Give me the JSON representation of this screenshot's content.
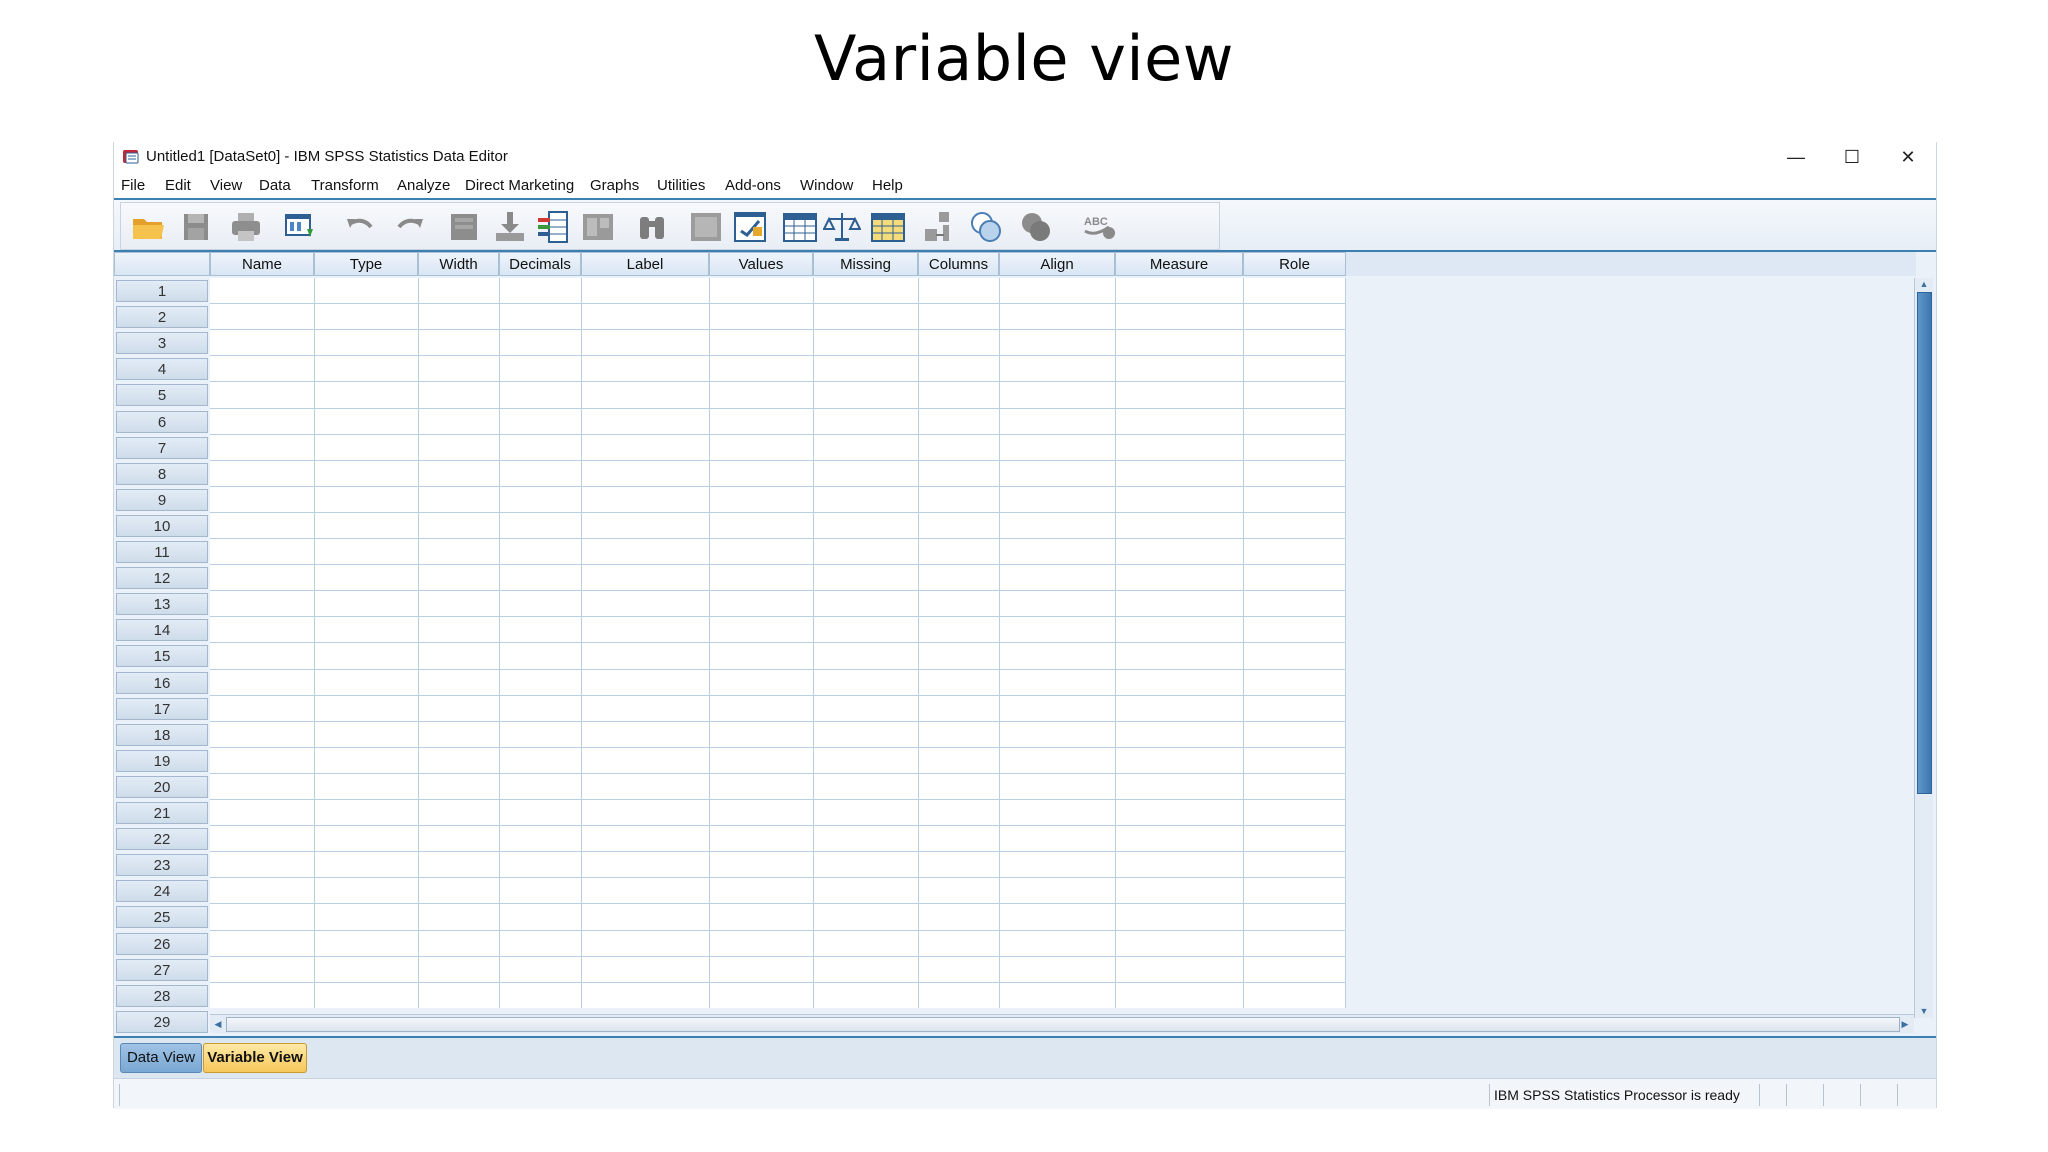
{
  "slide": {
    "title": "Variable view"
  },
  "window": {
    "title": "Untitled1 [DataSet0] - IBM SPSS Statistics Data Editor",
    "controls": {
      "minimize": "—",
      "maximize": "☐",
      "close": "✕"
    }
  },
  "menu": [
    "File",
    "Edit",
    "View",
    "Data",
    "Transform",
    "Analyze",
    "Direct Marketing",
    "Graphs",
    "Utilities",
    "Add-ons",
    "Window",
    "Help"
  ],
  "toolbar": {
    "buttons": [
      "open-folder",
      "save",
      "print",
      "recall-dialog",
      "undo",
      "redo",
      "go-to-case",
      "go-to-variable",
      "variables",
      "split-file",
      "find",
      "insert-cases",
      "insert-variable",
      "split-file-table",
      "weight-cases",
      "select-cases",
      "value-labels",
      "use-sets",
      "show-all-variables",
      "spell-check"
    ]
  },
  "grid": {
    "columns": [
      "Name",
      "Type",
      "Width",
      "Decimals",
      "Label",
      "Values",
      "Missing",
      "Columns",
      "Align",
      "Measure",
      "Role"
    ],
    "rows": [
      "1",
      "2",
      "3",
      "4",
      "5",
      "6",
      "7",
      "8",
      "9",
      "10",
      "11",
      "12",
      "13",
      "14",
      "15",
      "16",
      "17",
      "18",
      "19",
      "20",
      "21",
      "22",
      "23",
      "24",
      "25",
      "26",
      "27",
      "28",
      "29"
    ]
  },
  "tabs": {
    "data_view": "Data View",
    "variable_view": "Variable View",
    "active": "Variable View"
  },
  "status": {
    "text": "IBM SPSS Statistics Processor is ready"
  },
  "colors": {
    "accent": "#3c7fb1",
    "active_tab": "#f6c75a",
    "inactive_tab": "#7aa8d4",
    "grid_line": "#b9cfe4"
  }
}
